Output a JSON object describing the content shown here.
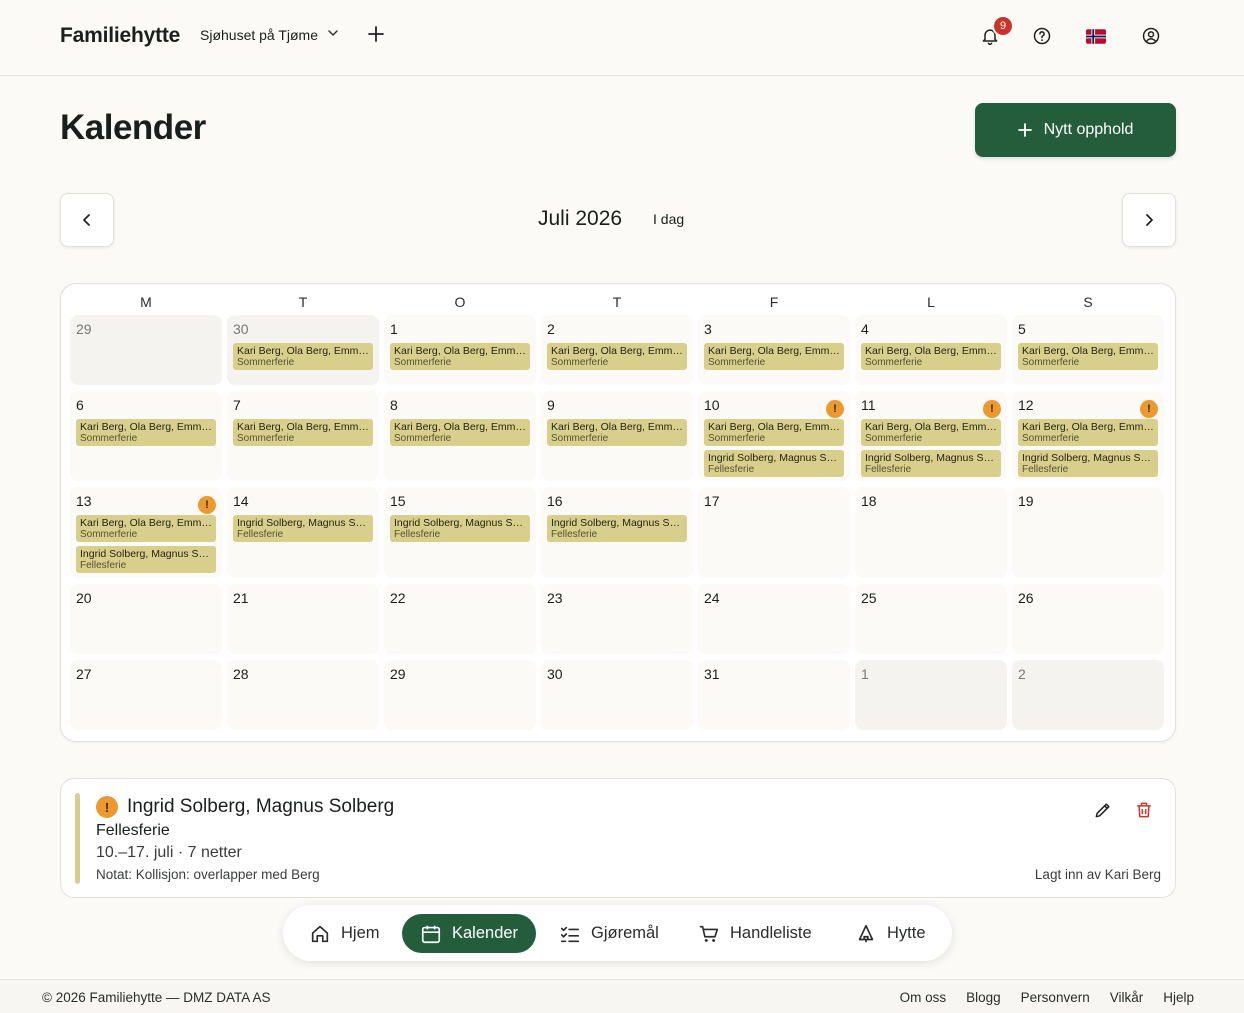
{
  "header": {
    "brand": "Familiehytte",
    "cabin_name": "Sjøhuset på Tjøme",
    "notification_count": "9",
    "flag": "🇳🇴"
  },
  "page": {
    "title": "Kalender",
    "new_stay_label": "Nytt opphold"
  },
  "calendar": {
    "month_label": "Juli 2026",
    "today_label": "I dag",
    "weekdays": [
      "M",
      "T",
      "O",
      "T",
      "F",
      "L",
      "S"
    ],
    "days": [
      {
        "num": "29",
        "out": true,
        "warn": false,
        "bookings": []
      },
      {
        "num": "30",
        "out": true,
        "warn": false,
        "bookings": [
          0
        ]
      },
      {
        "num": "1",
        "warn": false,
        "bookings": [
          0
        ]
      },
      {
        "num": "2",
        "warn": false,
        "bookings": [
          0
        ]
      },
      {
        "num": "3",
        "warn": false,
        "bookings": [
          0
        ]
      },
      {
        "num": "4",
        "warn": false,
        "bookings": [
          0
        ]
      },
      {
        "num": "5",
        "warn": false,
        "bookings": [
          0
        ]
      },
      {
        "num": "6",
        "warn": false,
        "bookings": [
          0
        ]
      },
      {
        "num": "7",
        "warn": false,
        "bookings": [
          0
        ]
      },
      {
        "num": "8",
        "warn": false,
        "bookings": [
          0
        ]
      },
      {
        "num": "9",
        "warn": false,
        "bookings": [
          0
        ]
      },
      {
        "num": "10",
        "warn": true,
        "bookings": [
          0,
          1
        ]
      },
      {
        "num": "11",
        "warn": true,
        "bookings": [
          0,
          1
        ]
      },
      {
        "num": "12",
        "warn": true,
        "bookings": [
          0,
          1
        ]
      },
      {
        "num": "13",
        "warn": true,
        "bookings": [
          0,
          1
        ]
      },
      {
        "num": "14",
        "warn": false,
        "bookings": [
          1
        ]
      },
      {
        "num": "15",
        "warn": false,
        "bookings": [
          1
        ]
      },
      {
        "num": "16",
        "warn": false,
        "bookings": [
          1
        ]
      },
      {
        "num": "17",
        "warn": false,
        "bookings": []
      },
      {
        "num": "18",
        "warn": false,
        "bookings": []
      },
      {
        "num": "19",
        "warn": false,
        "bookings": []
      },
      {
        "num": "20",
        "warn": false,
        "bookings": []
      },
      {
        "num": "21",
        "warn": false,
        "bookings": []
      },
      {
        "num": "22",
        "warn": false,
        "bookings": []
      },
      {
        "num": "23",
        "warn": false,
        "bookings": []
      },
      {
        "num": "24",
        "warn": false,
        "bookings": []
      },
      {
        "num": "25",
        "warn": false,
        "bookings": []
      },
      {
        "num": "26",
        "warn": false,
        "bookings": []
      },
      {
        "num": "27",
        "warn": false,
        "bookings": []
      },
      {
        "num": "28",
        "warn": false,
        "bookings": []
      },
      {
        "num": "29",
        "warn": false,
        "bookings": []
      },
      {
        "num": "30",
        "warn": false,
        "bookings": []
      },
      {
        "num": "31",
        "warn": false,
        "bookings": []
      },
      {
        "num": "1",
        "out": true,
        "warn": false,
        "bookings": []
      },
      {
        "num": "2",
        "out": true,
        "warn": false,
        "bookings": []
      }
    ],
    "bookings": [
      {
        "names": "Kari Berg, Ola Berg, Emm…",
        "label": "Sommerferie",
        "color": "#d8cf8c"
      },
      {
        "names": "Ingrid Solberg, Magnus S…",
        "label": "Fellesferie",
        "color": "#d8cf8c"
      }
    ],
    "warn_symbol": "!"
  },
  "detail": {
    "warn_symbol": "!",
    "title": "Ingrid Solberg, Magnus Solberg",
    "type": "Fellesferie",
    "dates": "10.–17. juli · 7 netter",
    "note": "Notat: Kollisjon: overlapper med Berg",
    "author": "Lagt inn av Kari Berg"
  },
  "bottom_nav": [
    {
      "label": "Hjem",
      "icon": "home-icon",
      "active": false
    },
    {
      "label": "Kalender",
      "icon": "calendar-icon",
      "active": true
    },
    {
      "label": "Gjøremål",
      "icon": "checklist-icon",
      "active": false
    },
    {
      "label": "Handleliste",
      "icon": "cart-icon",
      "active": false
    },
    {
      "label": "Hytte",
      "icon": "cabin-icon",
      "active": false
    }
  ],
  "footer": {
    "copyright": "© 2026 Familiehytte — DMZ DATA AS",
    "links": [
      "Om oss",
      "Blogg",
      "Personvern",
      "Vilkår",
      "Hjelp"
    ]
  },
  "colors": {
    "accent": "#245d3b",
    "booking": "#d8cf8c",
    "warning": "#ec9a30",
    "badge": "#c7352a"
  }
}
